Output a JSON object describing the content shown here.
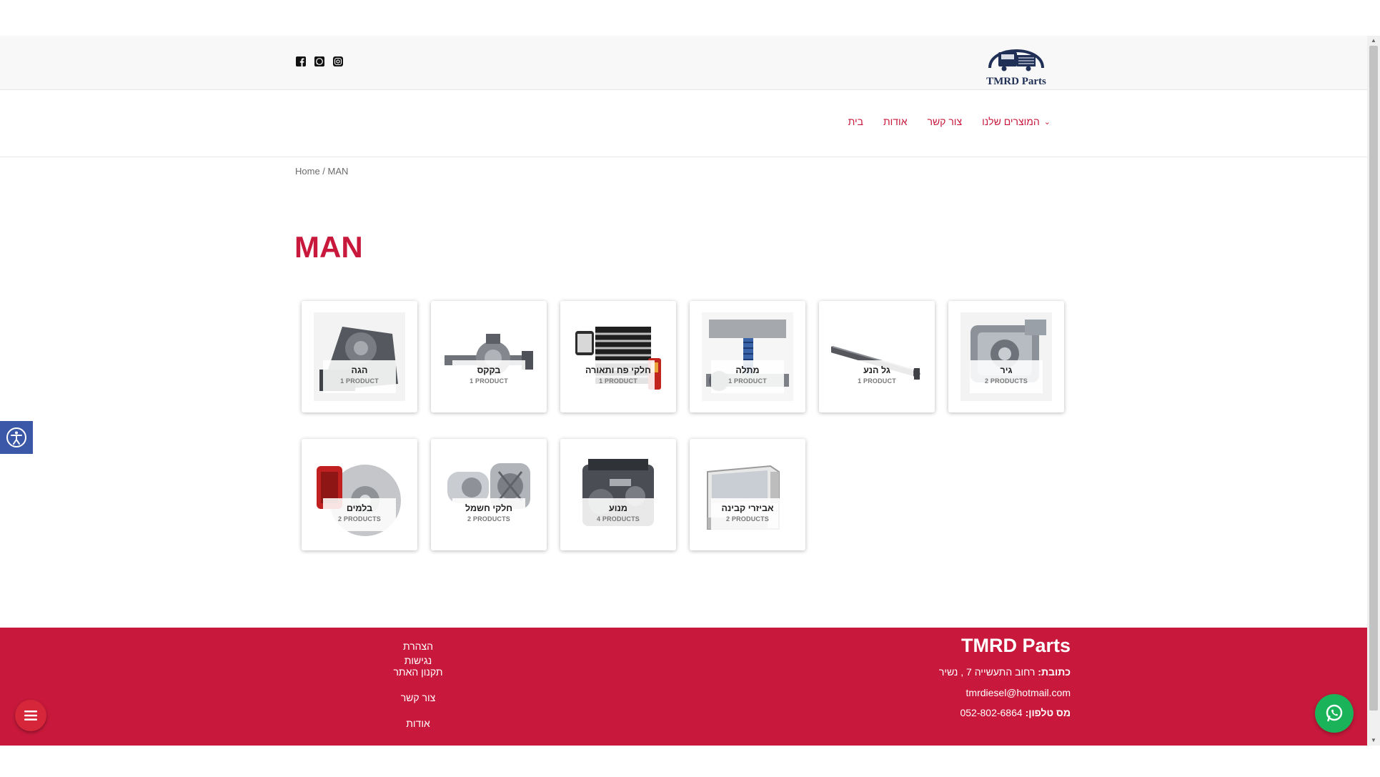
{
  "brand": {
    "logo_text": "TMRD Parts"
  },
  "social": [
    "facebook-icon",
    "whatsapp-icon",
    "instagram-icon"
  ],
  "nav": {
    "home": "בית",
    "about": "אודות",
    "contact": "צור קשר",
    "products": "המוצרים שלנו"
  },
  "breadcrumb": {
    "home": "Home",
    "sep": " / ",
    "current": "MAN"
  },
  "page_title": "MAN",
  "categories": [
    {
      "name": "גיר",
      "count": "2 PRODUCTS"
    },
    {
      "name": "גל הנע",
      "count": "1 PRODUCT"
    },
    {
      "name": "מתלה",
      "count": "1 PRODUCT"
    },
    {
      "name": "חלקי פח ותאורה",
      "count": "1 PRODUCT"
    },
    {
      "name": "בקקס",
      "count": "1 PRODUCT"
    },
    {
      "name": "הגה",
      "count": "1 PRODUCT"
    },
    {
      "name": "אביזרי קבינה",
      "count": "2 PRODUCTS"
    },
    {
      "name": "מנוע",
      "count": "4 PRODUCTS"
    },
    {
      "name": "חלקי חשמל",
      "count": "2 PRODUCTS"
    },
    {
      "name": "בלמים",
      "count": "2 PRODUCTS"
    }
  ],
  "footer": {
    "brand": "TMRD Parts",
    "address_label": "כתובת:",
    "address": "רחוב התעשייה 7 , נשיר",
    "email": "tmrdiesel@hotmail.com",
    "phone_label": "מס טלפון:",
    "phone": "052-802-6864",
    "links": [
      "הצהרת נגישות",
      "תקנון האתר",
      "צור קשר",
      "אודות"
    ]
  },
  "colors": {
    "accent": "#c8193c",
    "whatsapp": "#1bb35a",
    "accessibility": "#3b58a8"
  }
}
